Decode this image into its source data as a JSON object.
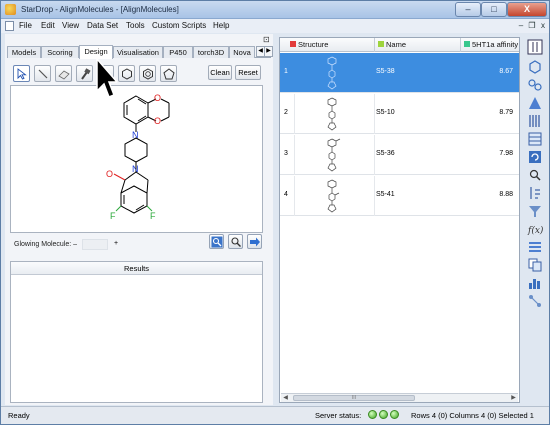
{
  "window": {
    "title": "StarDrop - AlignMolecules - [AlignMolecules]",
    "min_label": "–",
    "max_label": "□",
    "close_label": "X"
  },
  "menu": {
    "items": [
      "File",
      "Edit",
      "View",
      "Data Set",
      "Tools",
      "Custom Scripts",
      "Help"
    ],
    "mdi_min": "–",
    "mdi_restore": "❐",
    "mdi_close": "x"
  },
  "left_panel": {
    "pin_icon": "pin-icon",
    "tabs": [
      "Models",
      "Scoring",
      "Design",
      "Visualisation",
      "P450",
      "torch3D",
      "Nova"
    ],
    "active_tab": "Design",
    "tab_prev": "◀",
    "tab_next": "▶",
    "clean_label": "Clean",
    "reset_label": "Reset",
    "glowing_label": "Glowing Molecule: –",
    "glowing_plus": "+",
    "results_title": "Results"
  },
  "molecule": {
    "atom_o": "O",
    "atom_n": "N",
    "atom_f": "F",
    "colors": {
      "oxygen": "#e02020",
      "nitrogen": "#1f3fd8",
      "fluorine": "#2aa83a"
    }
  },
  "grid": {
    "columns": [
      {
        "label": "Structure",
        "color": "#e23b3b"
      },
      {
        "label": "Name",
        "color": "#9ed43d"
      },
      {
        "label": "5HT1a affinity",
        "color": "#38c78d"
      }
    ],
    "rows": [
      {
        "num": "1",
        "name": "S5-38",
        "affinity": "8.67",
        "selected": true
      },
      {
        "num": "2",
        "name": "S5-10",
        "affinity": "8.79",
        "selected": false
      },
      {
        "num": "3",
        "name": "S5-36",
        "affinity": "7.98",
        "selected": false
      },
      {
        "num": "4",
        "name": "S5-41",
        "affinity": "8.88",
        "selected": false
      }
    ],
    "scroll_left": "◀",
    "scroll_right": "▶",
    "scroll_grip": "III"
  },
  "status": {
    "ready": "Ready",
    "server": "Server status:",
    "rows_info": "Rows 4 (0) Columns 4 (0) Selected 1"
  }
}
